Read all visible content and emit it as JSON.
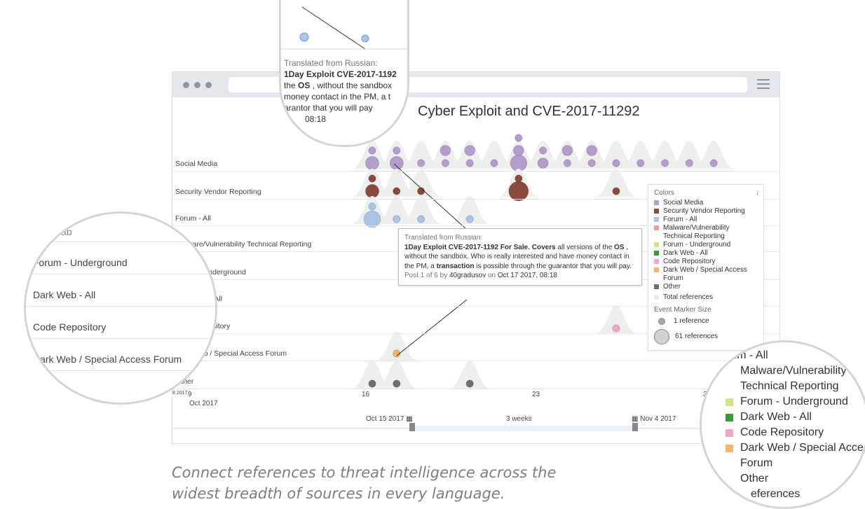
{
  "chart_data": {
    "type": "scatter",
    "title": "Cyber Exploit and CVE-2017-11292",
    "categories": [
      "Social Media",
      "Security Vendor Reporting",
      "Forum - All",
      "Malware/Vulnerability Technical Reporting",
      "Forum - Underground",
      "Dark Web - All",
      "Code Repository",
      "Dark Web / Special Access Forum",
      "Other"
    ],
    "x_ticks": [
      "9",
      "16",
      "23",
      "3"
    ],
    "x_tick_partial_left": "8 2017",
    "x_sublabel": "Oct 2017",
    "range_start": "Oct 15 2017",
    "range_mid": "3 weeks",
    "range_end": "Nov 4 2017",
    "series": [
      {
        "name": "Social Media",
        "color": "#b49ccd",
        "points": [
          {
            "day": 16,
            "refs": 3
          },
          {
            "day": 16,
            "refs": 1
          },
          {
            "day": 17,
            "refs": 3
          },
          {
            "day": 17,
            "refs": 1
          },
          {
            "day": 18,
            "refs": 1
          },
          {
            "day": 19,
            "refs": 1
          },
          {
            "day": 19,
            "refs": 2
          },
          {
            "day": 20,
            "refs": 1
          },
          {
            "day": 20,
            "refs": 2
          },
          {
            "day": 21,
            "refs": 1
          },
          {
            "day": 22,
            "refs": 4
          },
          {
            "day": 22,
            "refs": 2
          },
          {
            "day": 22,
            "refs": 1
          },
          {
            "day": 23,
            "refs": 2
          },
          {
            "day": 23,
            "refs": 1
          },
          {
            "day": 24,
            "refs": 1
          },
          {
            "day": 24,
            "refs": 2
          },
          {
            "day": 25,
            "refs": 1
          },
          {
            "day": 25,
            "refs": 2
          },
          {
            "day": 26,
            "refs": 1
          },
          {
            "day": 27,
            "refs": 1
          },
          {
            "day": 28,
            "refs": 1
          },
          {
            "day": 29,
            "refs": 1
          },
          {
            "day": 30,
            "refs": 1
          }
        ]
      },
      {
        "name": "Security Vendor Reporting",
        "color": "#8b4a3e",
        "points": [
          {
            "day": 16,
            "refs": 3
          },
          {
            "day": 16,
            "refs": 1
          },
          {
            "day": 17,
            "refs": 1
          },
          {
            "day": 18,
            "refs": 1
          },
          {
            "day": 22,
            "refs": 5
          },
          {
            "day": 22,
            "refs": 1
          },
          {
            "day": 26,
            "refs": 1
          }
        ]
      },
      {
        "name": "Forum - All",
        "color": "#a9c4e6",
        "points": [
          {
            "day": 16,
            "refs": 4
          },
          {
            "day": 16,
            "refs": 1
          },
          {
            "day": 17,
            "refs": 1
          },
          {
            "day": 18,
            "refs": 1
          },
          {
            "day": 20,
            "refs": 1
          }
        ]
      },
      {
        "name": "Code Repository",
        "color": "#f0a6c8",
        "points": [
          {
            "day": 26,
            "refs": 1
          }
        ]
      },
      {
        "name": "Dark Web / Special Access Forum",
        "color": "#f5b36b",
        "points": [
          {
            "day": 17,
            "refs": 1
          }
        ]
      },
      {
        "name": "Other",
        "color": "#6e6e6e",
        "points": [
          {
            "day": 16,
            "refs": 1
          },
          {
            "day": 17,
            "refs": 1
          },
          {
            "day": 20,
            "refs": 1
          }
        ]
      }
    ]
  },
  "tooltip": {
    "header": "Translated from Russian:",
    "title": "1Day Exploit CVE-2017-1192 For Sale.",
    "covers": "Covers",
    "t1": " all versions of the ",
    "os": "OS",
    "t2": " , without the sandbox. Who is really interested and have money contact in the PM, a ",
    "transaction": "transaction",
    "t3": " is possible through the guarantor that you will pay. ",
    "meta1": "Post 1 of 6 by ",
    "author": "40gradusov",
    "meta2": " on ",
    "date": "Oct 17 2017, 08:18"
  },
  "legend": {
    "title": "Colors",
    "collapse_icon": "chevron-double-down-icon",
    "items": [
      {
        "label": "Social Media",
        "color": "#b49ccd"
      },
      {
        "label": "Security Vendor Reporting",
        "color": "#8b4a3e"
      },
      {
        "label": "Forum - All",
        "color": "#a9c4e6"
      },
      {
        "label": "Malware/Vulnerability Technical Reporting",
        "color": "#f29a9a"
      },
      {
        "label": "Forum - Underground",
        "color": "#d9df8a"
      },
      {
        "label": "Dark Web - All",
        "color": "#3a9a3a"
      },
      {
        "label": "Code Repository",
        "color": "#f0a6c8"
      },
      {
        "label": "Dark Web / Special Access Forum",
        "color": "#f5b36b"
      },
      {
        "label": "Other",
        "color": "#6e6e6e"
      }
    ],
    "total_label": "Total references",
    "size_title": "Event Marker Size",
    "size_small": "1 reference",
    "size_large": "61 references"
  },
  "caption": {
    "line1": "Connect references to threat intelligence across the",
    "line2": "widest breadth of sources in every language."
  },
  "mag_left": {
    "top_partial": "Vulnerab",
    "items": [
      "Forum - Underground",
      "Dark Web - All",
      "Code Repository",
      "Dark Web / Special Access Forum"
    ],
    "bottom_partial": "Other"
  },
  "mag_right": {
    "items": [
      {
        "label": "rum - All",
        "color": ""
      },
      {
        "label": "Malware/Vulnerability",
        "color": ""
      },
      {
        "label": "Technical Reporting",
        "color": ""
      },
      {
        "label": "Forum - Underground",
        "color": "#d9df8a"
      },
      {
        "label": "Dark Web - All",
        "color": "#3a9a3a"
      },
      {
        "label": "Code Repository",
        "color": "#f0a6c8"
      },
      {
        "label": "Dark Web / Special Access",
        "color": "#f5b36b"
      },
      {
        "label": "Forum",
        "color": ""
      },
      {
        "label": "Other",
        "color": ""
      },
      {
        "label": "eferences",
        "color": ""
      }
    ]
  },
  "mag_top": {
    "line1": "Translated from Russian:",
    "line2": "1Day Exploit CVE-2017-1192",
    "line3a": "the ",
    "line3b": "OS",
    "line3c": " , without the sandbox",
    "line4": "money contact in the PM, a t",
    "line5": "arantor that you will pay",
    "line6": "08:18"
  }
}
